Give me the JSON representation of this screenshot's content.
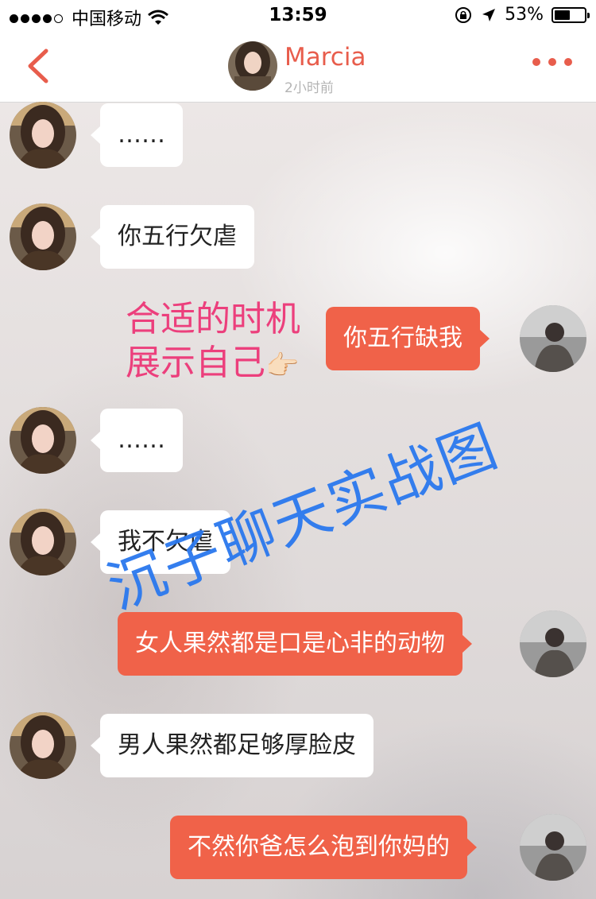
{
  "status_bar": {
    "carrier": "中国移动",
    "time": "13:59",
    "battery": "53%",
    "battery_level": 0.53
  },
  "header": {
    "contact_name": "Marcia",
    "last_seen": "2小时前"
  },
  "messages": [
    {
      "from": "her",
      "text": "……"
    },
    {
      "from": "her",
      "text": "你五行欠虐"
    },
    {
      "from": "me",
      "text": "你五行缺我"
    },
    {
      "from": "her",
      "text": "……"
    },
    {
      "from": "her",
      "text": "我不欠虐"
    },
    {
      "from": "me",
      "text": "女人果然都是口是心非的动物"
    },
    {
      "from": "her",
      "text": "男人果然都足够厚脸皮"
    },
    {
      "from": "me",
      "text": "不然你爸怎么泡到你妈的"
    }
  ],
  "annotation": {
    "line1": "合适的时机",
    "line2": "展示自己",
    "hand": "👉🏻"
  },
  "watermark": "沉子聊天实战图",
  "colors": {
    "accent": "#e85d4c",
    "sent_bubble": "#f06249",
    "received_bubble": "#ffffff",
    "annotation": "#ec3f7c",
    "watermark": "#2a78ee"
  },
  "icons": {
    "back": "chevron-left-icon",
    "more": "more-dots-icon",
    "wifi": "wifi-icon",
    "lock": "rotation-lock-icon",
    "location": "location-arrow-icon",
    "battery": "battery-icon"
  }
}
